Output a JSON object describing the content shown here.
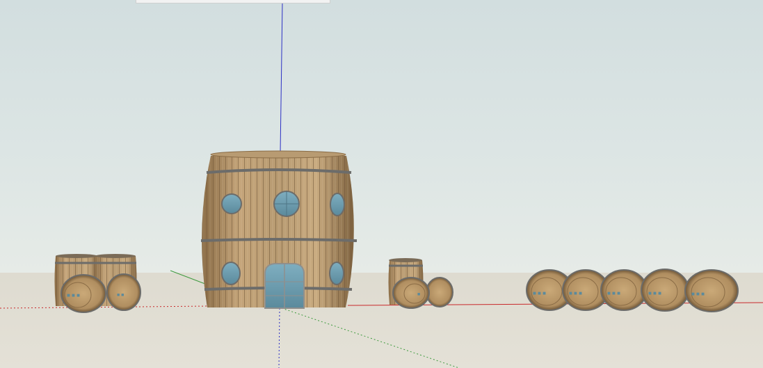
{
  "app": {
    "view": "3D model viewport",
    "tool_hint": ""
  },
  "colors": {
    "sky_top": "#d2dedf",
    "ground": "#dedbd0",
    "wood_light": "#c9ab7f",
    "wood_dark": "#7e623f",
    "iron_band": "#6c6c6a",
    "glass": "#6c9db0",
    "axis_red": "#c8282a",
    "axis_green": "#3d9a3d",
    "axis_blue": "#2b2fc4"
  },
  "scene": {
    "objects": [
      {
        "name": "barrel-house",
        "kind": "large barrel building with round windows and door"
      },
      {
        "name": "barrel-group-left",
        "kind": "stacked barrels"
      },
      {
        "name": "barrel-group-middle",
        "kind": "stacked barrels"
      },
      {
        "name": "barrel-row-right",
        "kind": "row of five barrels on side",
        "count": 5
      }
    ],
    "axes": [
      "red",
      "green",
      "blue"
    ]
  }
}
